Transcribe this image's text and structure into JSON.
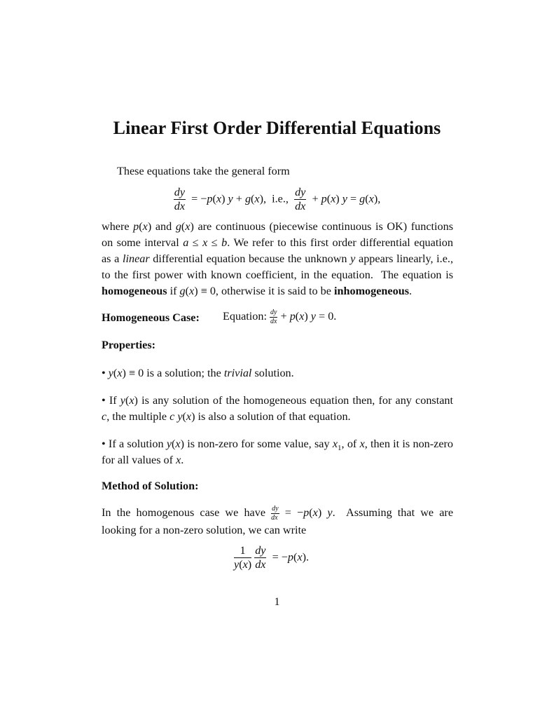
{
  "document": {
    "title": "Linear First Order Differential Equations",
    "intro": "These equations take the general form",
    "general_form": {
      "lhs_num": "dy",
      "lhs_den": "dx",
      "middle": "= −p(x) y + g(x),  i.e.,",
      "rhs_num": "dy",
      "rhs_den": "dx",
      "rhs_rest": "+ p(x) y = g(x),"
    },
    "paragraph1": [
      "where p(x) and g(x) are continuous (piecewise continuous is OK) functions",
      "on some interval a ≤ x ≤ b. We refer to this first order differential equation",
      "as a linear differential equation because the unknown y appears linearly, i.e.,",
      "to the first power with known coefficient, in the equation. The equation is",
      "homogeneous if g(x) ≡ 0, otherwise it is said to be inhomogeneous."
    ],
    "homogeneous_case": {
      "heading": "Homogeneous Case:",
      "label": "Equation:",
      "frac_num": "dy",
      "frac_den": "dx",
      "rest": "+ p(x) y = 0."
    },
    "properties_heading": "Properties:",
    "properties": [
      "• y(x) ≡ 0 is a solution; the trivial solution.",
      "• If y(x) is any solution of the homogeneous equation then, for any constant c, the multiple c y(x) is also a solution of that equation.",
      "• If a solution y(x) is non-zero for some value, say x₁, of x, then it is non-zero for all values of x."
    ],
    "method_heading": "Method of Solution:",
    "method_text": [
      "In the homogenous case we have dy/dx = −p(x) y. Assuming that we are",
      "looking for a non-zero solution, we can write"
    ],
    "final_equation": {
      "frac1_num": "1",
      "frac1_den": "y(x)",
      "frac2_num": "dy",
      "frac2_den": "dx",
      "rest": "= −p(x)."
    },
    "page_number": "1"
  }
}
